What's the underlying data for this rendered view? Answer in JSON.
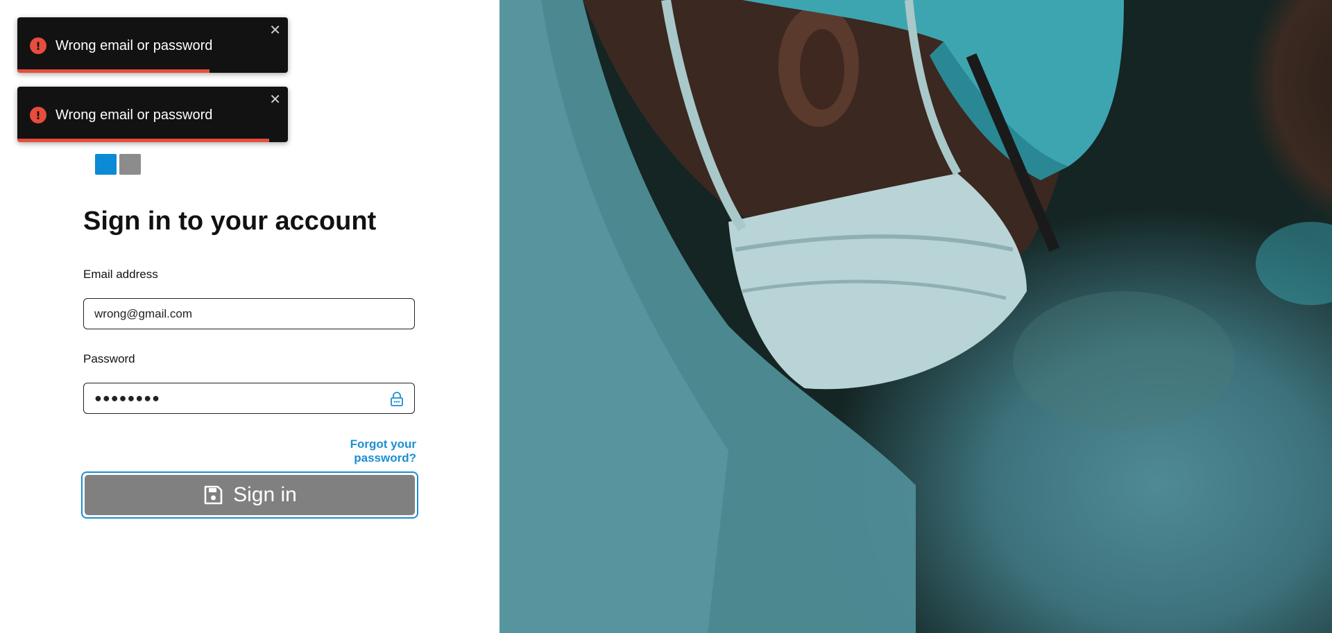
{
  "toasts": [
    {
      "message": "Wrong email or password",
      "close": "✕",
      "icon": "error-icon",
      "icon_glyph": "!",
      "progress": 0.71
    },
    {
      "message": "Wrong email or password",
      "close": "✕",
      "icon": "error-icon",
      "icon_glyph": "!",
      "progress": 0.93
    }
  ],
  "form": {
    "title": "Sign in to your account",
    "email_label": "Email address",
    "email_value": "wrong@gmail.com",
    "password_label": "Password",
    "password_value": "●●●●●●●●",
    "forgot_link": "Forgot your password?",
    "signin_label": "Sign in",
    "signin_icon": "save-icon",
    "lock_icon": "lock-icon"
  },
  "colors": {
    "accent": "#1a8fd1",
    "error": "#e74c3c",
    "button_bg": "#808080",
    "toast_bg": "#121212",
    "logo_blue": "#0b8ad6"
  },
  "hero_image": "surgeon-photo"
}
